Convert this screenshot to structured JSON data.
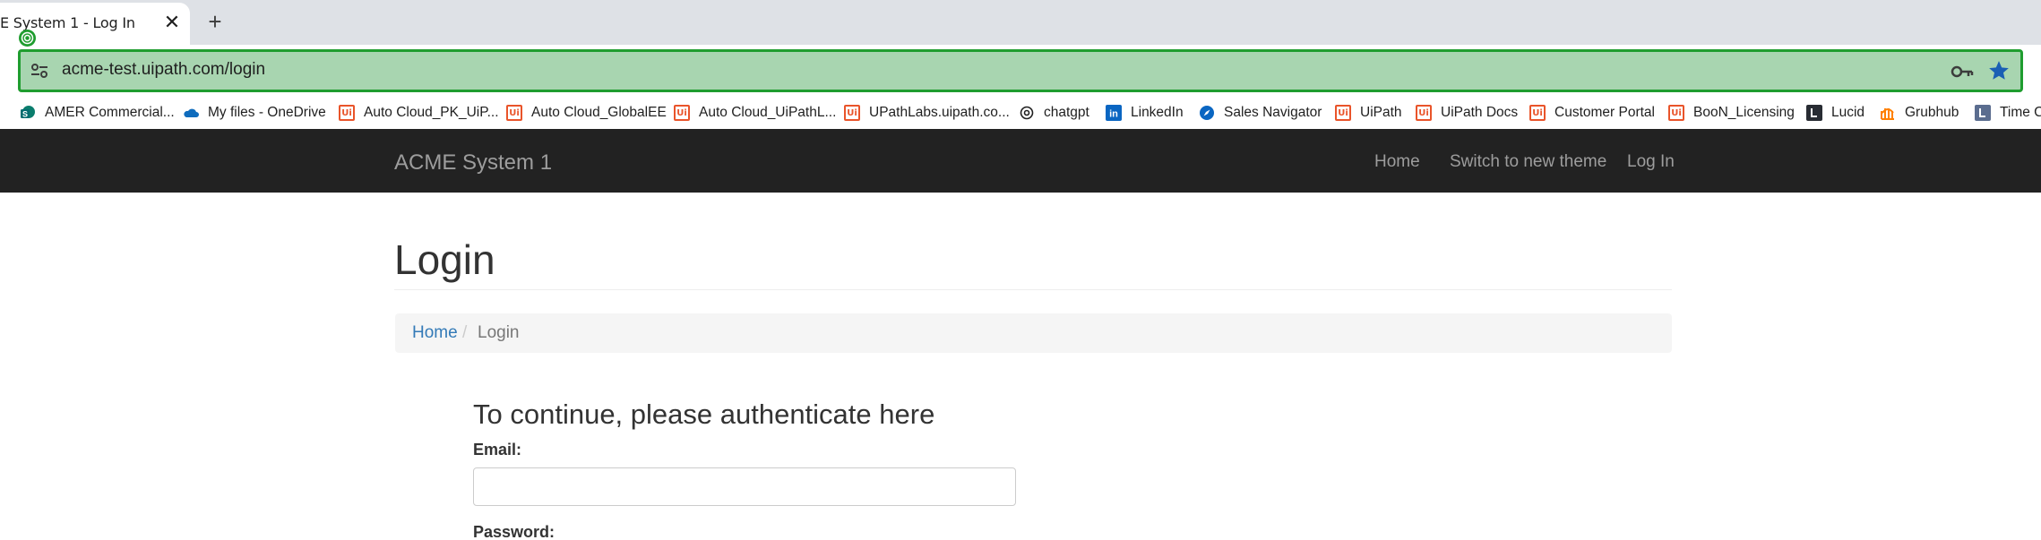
{
  "browser": {
    "tab": {
      "title": "E System 1 - Log In",
      "close": "✕"
    },
    "new_tab": "+",
    "url": "acme-test.uipath.com/login",
    "bookmarks": [
      {
        "label": "AMER Commercial...",
        "icon": "sharepoint-icon"
      },
      {
        "label": "My files - OneDrive",
        "icon": "onedrive-icon"
      },
      {
        "label": "Auto Cloud_PK_UiP...",
        "icon": "uipath-icon"
      },
      {
        "label": "Auto Cloud_GlobalEE",
        "icon": "uipath-icon"
      },
      {
        "label": "Auto Cloud_UiPathL...",
        "icon": "uipath-icon"
      },
      {
        "label": "UPathLabs.uipath.co...",
        "icon": "uipath-icon"
      },
      {
        "label": "chatgpt",
        "icon": "openai-icon"
      },
      {
        "label": "LinkedIn",
        "icon": "linkedin-icon"
      },
      {
        "label": "Sales Navigator",
        "icon": "compass-icon"
      },
      {
        "label": "UiPath",
        "icon": "uipath-icon"
      },
      {
        "label": "UiPath Docs",
        "icon": "uipath-icon"
      },
      {
        "label": "Customer Portal",
        "icon": "uipath-icon"
      },
      {
        "label": "BooN_Licensing",
        "icon": "uipath-icon"
      },
      {
        "label": "Lucid",
        "icon": "lucid-icon"
      },
      {
        "label": "Grubhub",
        "icon": "grubhub-icon"
      },
      {
        "label": "Time C",
        "icon": "time-icon"
      }
    ]
  },
  "navbar": {
    "brand": "ACME System 1",
    "links": [
      "Home",
      "Switch to new theme",
      "Log In"
    ]
  },
  "page": {
    "title": "Login",
    "breadcrumb": {
      "home": "Home",
      "separator": "/",
      "current": "Login"
    },
    "form": {
      "heading": "To continue, please authenticate here",
      "email_label": "Email:",
      "email_value": "",
      "password_label": "Password:"
    }
  },
  "colors": {
    "navbar_bg": "#222222",
    "omnibox_highlight": "#a8d5b0",
    "omnibox_border": "#1f9d2f",
    "link": "#337ab7",
    "uipath_orange": "#e9542a"
  }
}
